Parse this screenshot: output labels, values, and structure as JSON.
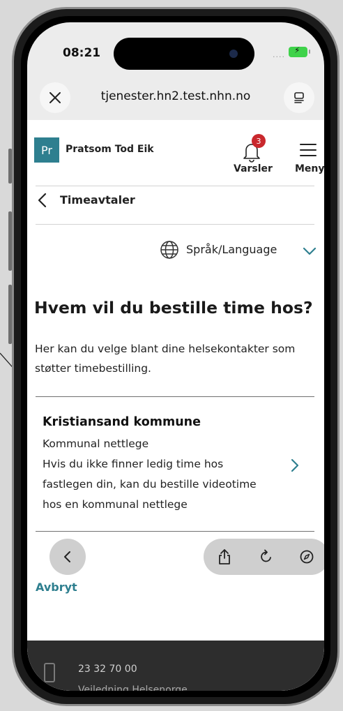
{
  "status_bar": {
    "time": "08:21",
    "signal": "....",
    "battery_color": "#3fd24a"
  },
  "browser": {
    "url": "tjenester.hn2.test.nhn.no"
  },
  "header": {
    "logo_initials": "Pr",
    "user_name": "Pratsom Tod Eik",
    "notifications": {
      "label": "Varsler",
      "count": "3"
    },
    "menu_label": "Meny"
  },
  "breadcrumb": {
    "back_label": "Timeavtaler"
  },
  "language": {
    "label": "Språk/Language"
  },
  "main": {
    "heading": "Hvem vil du bestille time hos?",
    "intro": "Her kan du velge blant dine helsekontakter som støtter timebestilling.",
    "contact": {
      "name": "Kristiansand kommune",
      "type": "Kommunal nettlege",
      "description": "Hvis du ikke finner ledig time hos fastlegen din, kan du bestille videotime hos en kommunal nettlege"
    },
    "cancel_label": "Avbryt"
  },
  "footer": {
    "phone": "23 32 70 00",
    "guide": "Veiledning Helsenorge"
  },
  "colors": {
    "accent": "#2e7f8f",
    "badge": "#c9282d",
    "footer_bg": "#2d2d2d"
  }
}
